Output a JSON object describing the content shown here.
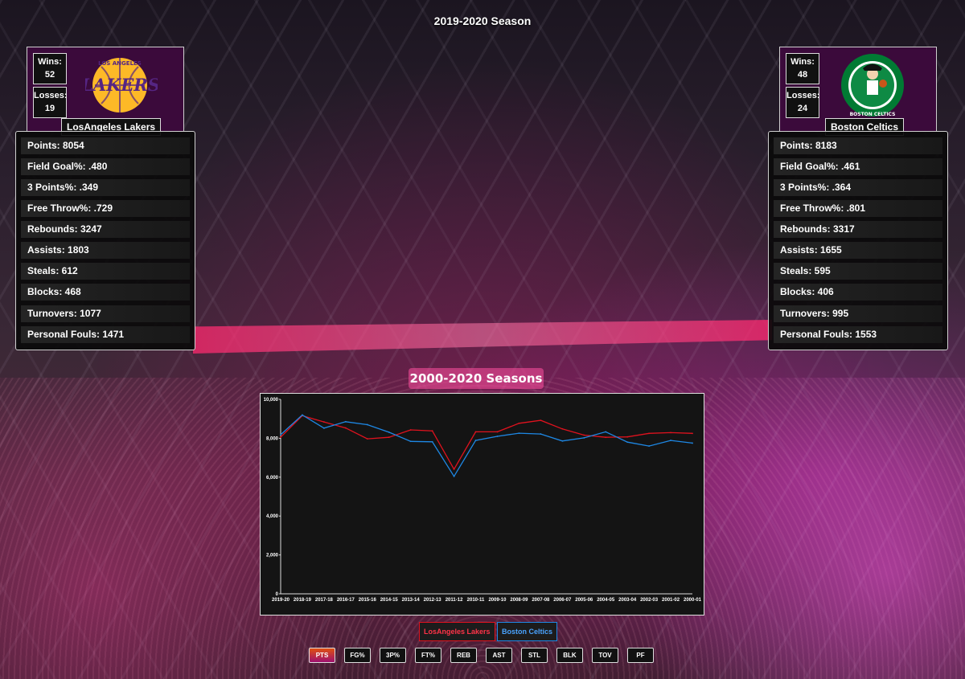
{
  "season_title": "2019-2020 Season",
  "arena_sign": "2000-2020 Seasons",
  "teams": {
    "lakers": {
      "name": "LosAngeles Lakers",
      "wins_label": "Wins:",
      "wins": "52",
      "losses_label": "Losses:",
      "losses": "19",
      "logo_text": "LAKERS",
      "logo_subtext": "LOS ANGELES",
      "color": "#552583",
      "accent": "#FDB927",
      "stats": [
        "Points: 8054",
        "Field Goal%: .480",
        "3 Points%: .349",
        "Free Throw%: .729",
        "Rebounds: 3247",
        "Assists: 1803",
        "Steals: 612",
        "Blocks: 468",
        "Turnovers: 1077",
        "Personal Fouls: 1471"
      ]
    },
    "celtics": {
      "name": "Boston Celtics",
      "wins_label": "Wins:",
      "wins": "48",
      "losses_label": "Losses:",
      "losses": "24",
      "logo_text": "BOSTON CELTICS",
      "color": "#007A33",
      "stats": [
        "Points: 8183",
        "Field Goal%: .461",
        "3 Points%: .364",
        "Free Throw%: .801",
        "Rebounds: 3317",
        "Assists: 1655",
        "Steals: 595",
        "Blocks: 406",
        "Turnovers: 995",
        "Personal Fouls: 1553"
      ]
    }
  },
  "legend": {
    "lakers_label": "LosAngeles Lakers",
    "celtics_label": "Boston Celtics"
  },
  "stat_buttons": [
    "PTS",
    "FG%",
    "3P%",
    "FT%",
    "REB",
    "AST",
    "STL",
    "BLK",
    "TOV",
    "PF"
  ],
  "active_stat": "PTS",
  "chart_data": {
    "type": "line",
    "x": [
      "2019-20",
      "2018-19",
      "2017-18",
      "2016-17",
      "2015-16",
      "2014-15",
      "2013-14",
      "2012-13",
      "2011-12",
      "2010-11",
      "2009-10",
      "2008-09",
      "2007-08",
      "2006-07",
      "2005-06",
      "2004-05",
      "2003-04",
      "2002-03",
      "2001-02",
      "2000-01"
    ],
    "ylim": [
      0,
      10000
    ],
    "yticks": [
      "0",
      "2,000",
      "4,000",
      "6,000",
      "8,000",
      "10,000"
    ],
    "ytick_values": [
      0,
      2000,
      4000,
      6000,
      8000,
      10000
    ],
    "series": [
      {
        "name": "LosAngeles Lakers",
        "color": "#e0121e",
        "values": [
          8054,
          9160,
          8840,
          8530,
          7970,
          8050,
          8430,
          8380,
          6410,
          8330,
          8330,
          8770,
          8920,
          8480,
          8160,
          8050,
          8070,
          8250,
          8290,
          8250
        ]
      },
      {
        "name": "Boston Celtics",
        "color": "#1e88e5",
        "values": [
          8183,
          9200,
          8520,
          8850,
          8700,
          8310,
          7840,
          7820,
          6040,
          7890,
          8100,
          8260,
          8220,
          7860,
          8020,
          8330,
          7800,
          7600,
          7890,
          7750
        ]
      }
    ]
  }
}
